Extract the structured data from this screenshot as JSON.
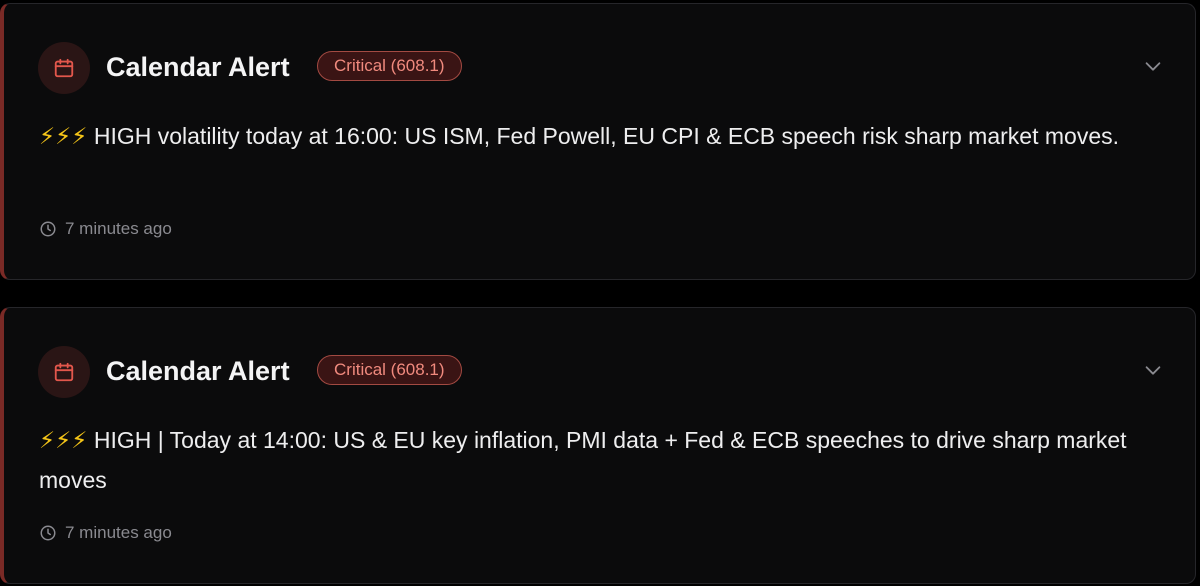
{
  "colors": {
    "accent_border": "#7a2a26",
    "badge_text": "#f08a7e",
    "badge_bg": "#3a1414",
    "bolt": "#f5c518"
  },
  "alerts": [
    {
      "icon": "calendar-icon",
      "title": "Calendar Alert",
      "badge": "Critical (608.1)",
      "bolts": "⚡⚡⚡",
      "message": " HIGH volatility today at 16:00: US ISM, Fed Powell, EU CPI & ECB speech risk sharp market moves.",
      "timestamp": "7 minutes ago"
    },
    {
      "icon": "calendar-icon",
      "title": "Calendar Alert",
      "badge": "Critical (608.1)",
      "bolts": "⚡⚡⚡",
      "message": " HIGH | Today at 14:00: US & EU key inflation, PMI data + Fed & ECB speeches to drive sharp market moves",
      "timestamp": "7 minutes ago"
    }
  ]
}
